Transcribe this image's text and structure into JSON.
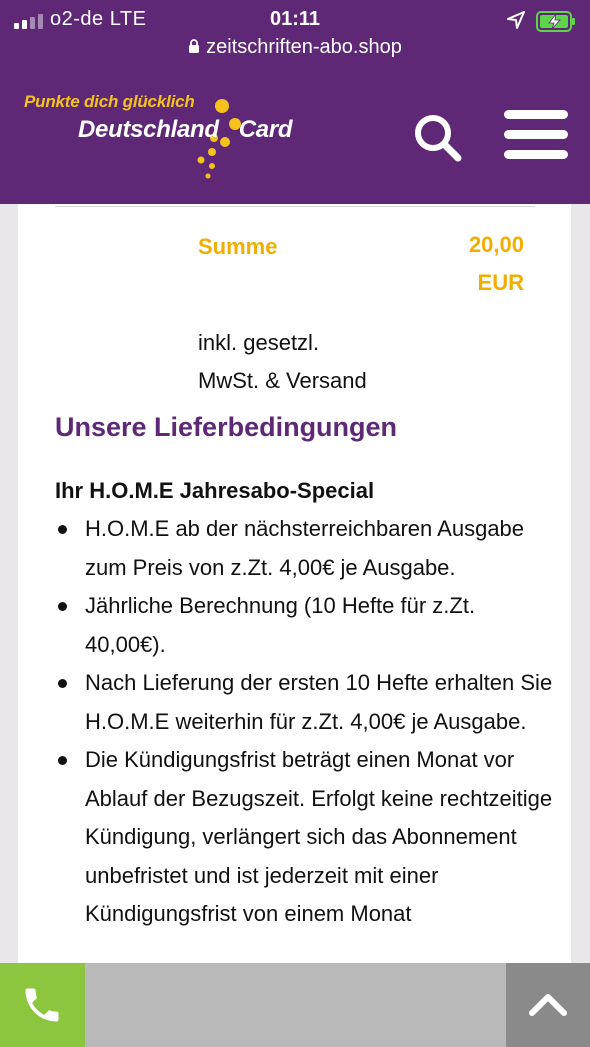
{
  "status_bar": {
    "carrier": "o2-de  LTE",
    "time": "01:11",
    "url": "zeitschriften-abo.shop"
  },
  "header": {
    "logo_tagline": "Punkte dich glücklich",
    "logo_name_part1": "Deutschland",
    "logo_name_part2": "Card",
    "brand_color": "#5e2877",
    "accent_color": "#f4c21b"
  },
  "summary": {
    "sum_label": "Summe",
    "sum_amount": "20,00",
    "sum_currency": "EUR",
    "vat_line1": "inkl. gesetzl.",
    "vat_line2": "MwSt. & Versand"
  },
  "delivery": {
    "section_title": "Unsere Lieferbedingungen",
    "offer_title": "Ihr H.O.M.E Jahresabo-Special",
    "bullets": [
      "H.O.M.E ab der nächsterreichbaren Ausgabe zum Preis von z.Zt. 4,00€ je Ausgabe.",
      "Jährliche Berechnung (10 Hefte für z.Zt. 40,00€).",
      "Nach Lieferung der ersten 10 Hefte erhalten Sie H.O.M.E weiterhin für z.Zt. 4,00€ je Ausgabe.",
      "Die Kündigungsfrist beträgt einen Monat vor Ablauf der Bezugszeit. Erfolgt keine rechtzeitige Kündigung, verlängert sich das Abonnement unbefristet und ist jederzeit mit einer Kündigungsfrist von einem Monat"
    ]
  },
  "floating_bar": {
    "phone_icon": "phone-icon",
    "scroll_top_icon": "chevron-up-icon",
    "phone_color": "#8cc63f"
  }
}
